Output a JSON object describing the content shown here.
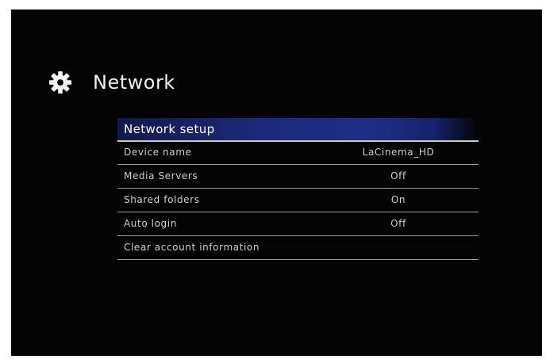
{
  "screen": {
    "title": "Network",
    "icon": "gear-icon"
  },
  "menu": {
    "header": "Network setup",
    "items": [
      {
        "label": "Device name",
        "value": "LaCinema_HD"
      },
      {
        "label": "Media Servers",
        "value": "Off"
      },
      {
        "label": "Shared folders",
        "value": "On"
      },
      {
        "label": "Auto login",
        "value": "Off"
      },
      {
        "label": "Clear account information",
        "value": ""
      }
    ]
  },
  "colors": {
    "background": "#030303",
    "highlight": "#1e2f86",
    "text": "#cfcfcf"
  }
}
